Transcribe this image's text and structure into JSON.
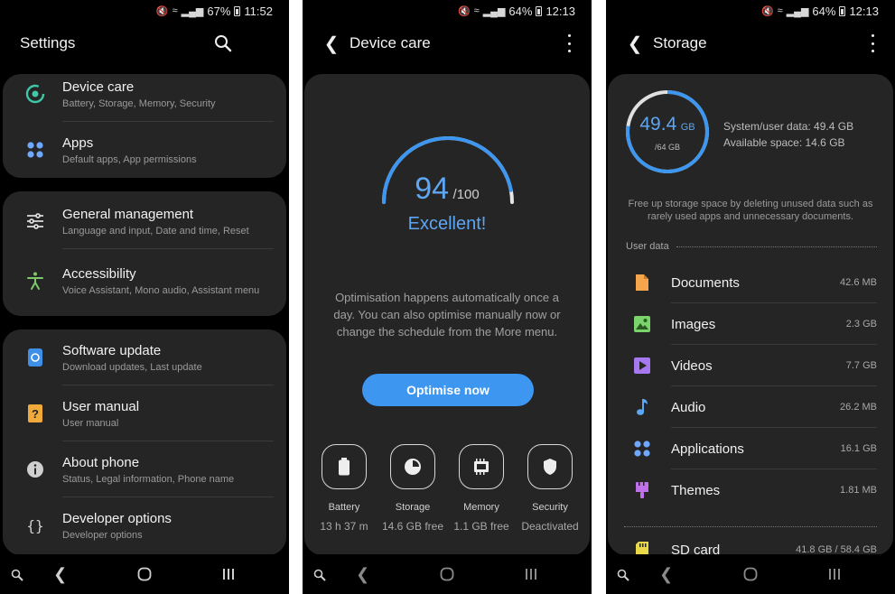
{
  "colors": {
    "accent": "#5ea5f2",
    "button": "#3d96ef",
    "card": "#252525",
    "background": "#000000"
  },
  "screens": {
    "settings": {
      "status": {
        "battery": "67%",
        "time": "11:52"
      },
      "title": "Settings",
      "icons": {
        "search": "search-icon"
      },
      "groups": [
        {
          "items": [
            {
              "title": "Device care",
              "subtitle": "Battery, Storage, Memory, Security",
              "icon": "device-care-icon",
              "color": "#3fc7a6"
            },
            {
              "title": "Apps",
              "subtitle": "Default apps, App permissions",
              "icon": "apps-icon",
              "color": "#6ea8ff"
            }
          ]
        },
        {
          "items": [
            {
              "title": "General management",
              "subtitle": "Language and input, Date and time, Reset",
              "icon": "sliders-icon",
              "color": "#dcdcdc"
            },
            {
              "title": "Accessibility",
              "subtitle": "Voice Assistant, Mono audio, Assistant menu",
              "icon": "accessibility-icon",
              "color": "#7ec96a"
            }
          ]
        },
        {
          "items": [
            {
              "title": "Software update",
              "subtitle": "Download updates, Last update",
              "icon": "software-update-icon",
              "color": "#3d8fe8"
            },
            {
              "title": "User manual",
              "subtitle": "User manual",
              "icon": "user-manual-icon",
              "color": "#f0a93b"
            },
            {
              "title": "About phone",
              "subtitle": "Status, Legal information, Phone name",
              "icon": "info-icon",
              "color": "#cfcfcf"
            },
            {
              "title": "Developer options",
              "subtitle": "Developer options",
              "icon": "code-braces-icon",
              "color": "#cfcfcf"
            }
          ]
        }
      ]
    },
    "device_care": {
      "status": {
        "battery": "64%",
        "time": "12:13"
      },
      "title": "Device care",
      "score": "94",
      "score_max": "/100",
      "score_fraction": 0.94,
      "rating": "Excellent!",
      "description": "Optimisation happens automatically once a day. You can also optimise manually now or change the schedule from the More menu.",
      "optimise_label": "Optimise now",
      "tiles": [
        {
          "label": "Battery",
          "value": "13 h 37 m",
          "icon": "battery-icon"
        },
        {
          "label": "Storage",
          "value": "14.6 GB free",
          "icon": "storage-pie-icon"
        },
        {
          "label": "Memory",
          "value": "1.1 GB free",
          "icon": "memory-chip-icon"
        },
        {
          "label": "Security",
          "value": "Deactivated",
          "icon": "shield-icon"
        }
      ]
    },
    "storage": {
      "status": {
        "battery": "64%",
        "time": "12:13"
      },
      "title": "Storage",
      "used": "49.4",
      "used_unit": "GB",
      "total": "/64 GB",
      "used_fraction": 0.772,
      "system_user_data": "System/user data: 49.4 GB",
      "available_space": "Available space: 14.6 GB",
      "hint": "Free up storage space by deleting unused data such as rarely used apps and unnecessary documents.",
      "section_label": "User data",
      "items": [
        {
          "name": "Documents",
          "size": "42.6 MB",
          "icon": "document-icon",
          "color": "#f5a54b"
        },
        {
          "name": "Images",
          "size": "2.3 GB",
          "icon": "image-icon",
          "color": "#7bd36b"
        },
        {
          "name": "Videos",
          "size": "7.7 GB",
          "icon": "video-icon",
          "color": "#a678f0"
        },
        {
          "name": "Audio",
          "size": "26.2 MB",
          "icon": "music-note-icon",
          "color": "#5aa8f5"
        },
        {
          "name": "Applications",
          "size": "16.1 GB",
          "icon": "apps-icon",
          "color": "#6ea8ff"
        },
        {
          "name": "Themes",
          "size": "1.81 MB",
          "icon": "brush-icon",
          "color": "#c070e8"
        }
      ],
      "sd_card": {
        "name": "SD card",
        "size": "41.8 GB / 58.4 GB",
        "icon": "sd-card-icon",
        "color": "#e8d84a"
      }
    }
  }
}
